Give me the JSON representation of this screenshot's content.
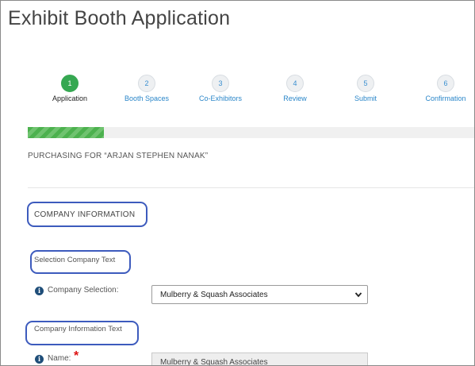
{
  "page": {
    "title": "Exhibit Booth Application"
  },
  "steps": [
    {
      "number": "1",
      "label": "Application",
      "state": "active"
    },
    {
      "number": "2",
      "label": "Booth Spaces",
      "state": "inactive"
    },
    {
      "number": "3",
      "label": "Co-Exhibitors",
      "state": "inactive"
    },
    {
      "number": "4",
      "label": "Review",
      "state": "inactive"
    },
    {
      "number": "5",
      "label": "Submit",
      "state": "inactive"
    },
    {
      "number": "6",
      "label": "Confirmation",
      "state": "inactive"
    }
  ],
  "progress": {
    "fraction": 0.17
  },
  "purchasing_text": "PURCHASING FOR “ARJAN STEPHEN NANAK”",
  "sections": {
    "company_information_heading": "COMPANY INFORMATION",
    "selection_company_text": "Selection Company Text",
    "company_information_text": "Company Information Text"
  },
  "fields": {
    "company_selection": {
      "label": "Company Selection:",
      "value": "Mulberry & Squash Associates"
    },
    "name": {
      "label": "Name:",
      "required_marker": "*",
      "value": "Mulberry & Squash Associates"
    }
  },
  "icons": {
    "info": "i"
  },
  "colors": {
    "accent_green": "#36a852",
    "link_blue": "#2a86c9",
    "annotation_outline": "#3d5bbd",
    "required_red": "#dd1111"
  }
}
